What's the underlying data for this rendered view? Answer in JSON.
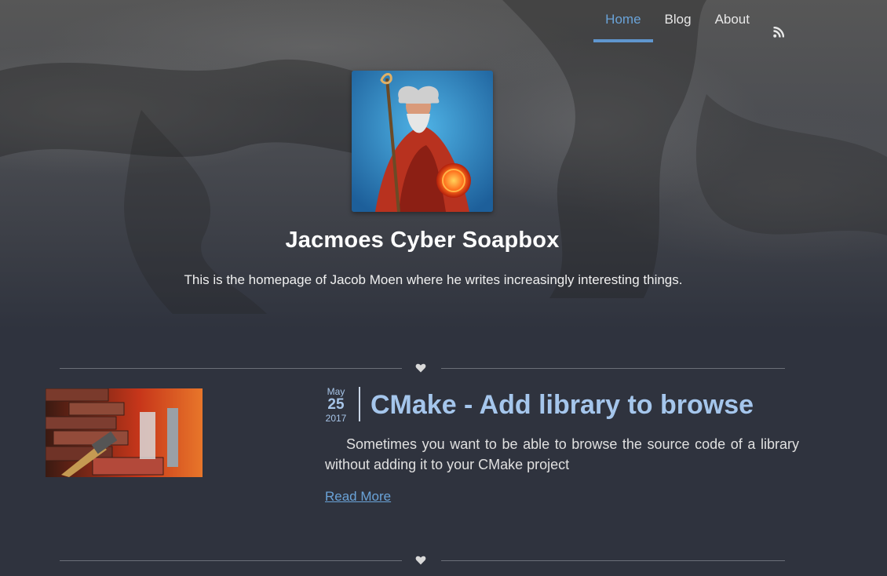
{
  "nav": {
    "items": [
      {
        "label": "Home",
        "active": true
      },
      {
        "label": "Blog",
        "active": false
      },
      {
        "label": "About",
        "active": false
      }
    ],
    "rss_icon": "rss-icon"
  },
  "profile": {
    "title": "Jacmoes Cyber Soapbox",
    "description": "This is the homepage of Jacob Moen where he writes increasingly interesting things."
  },
  "post": {
    "date": {
      "month": "May",
      "day": "25",
      "year": "2017"
    },
    "title": "CMake - Add library to browse",
    "excerpt": "Sometimes you want to be able to browse the source code of a library without adding it to your CMake project",
    "read_more": "Read More"
  },
  "colors": {
    "accent": "#5f96cf",
    "title_link": "#a5c6ec",
    "background": "#2f333e"
  },
  "icons": {
    "divider": "heart-icon"
  }
}
